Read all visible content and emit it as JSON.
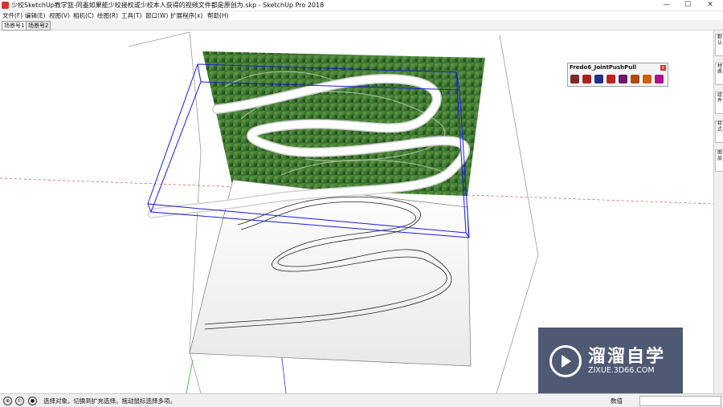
{
  "window": {
    "title": "少校SketchUp教学篮-同墨如果能少校接权或少校本人获得的视频文件都是原创为.skp - SketchUp Pro 2018",
    "minimize": "—",
    "maximize": "☐",
    "close": "✕"
  },
  "menu": [
    "文件(F)",
    "编辑(E)",
    "视图(V)",
    "相机(C)",
    "绘图(R)",
    "工具(T)",
    "窗口(W)",
    "扩展程序(x)",
    "帮助(H)"
  ],
  "scenes": [
    "场景号1",
    "场景号2"
  ],
  "right_panel_tabs": [
    "默认",
    "材质",
    "组件",
    "样式",
    "图层"
  ],
  "toolbar": {
    "title": "Fredo6_JointPushPull",
    "close": "x",
    "tool_colors": [
      "#7a2a2a",
      "#b02020",
      "#20308c",
      "#c02020",
      "#6a1a6a",
      "#b04a10",
      "#d06010",
      "#b01090"
    ]
  },
  "status": {
    "text": "选择对象。切换到扩充选择。拖动鼠标选择多项。",
    "measure_label": "数值",
    "measure_value": ""
  },
  "watermark": {
    "title": "溜溜自学",
    "url": "ZIXUE.3D66.COM"
  },
  "colors": {
    "selection": "#1b1bd6",
    "axis_red": "#cc3333",
    "axis_green": "#33aa33",
    "axis_blue": "#3333cc"
  }
}
